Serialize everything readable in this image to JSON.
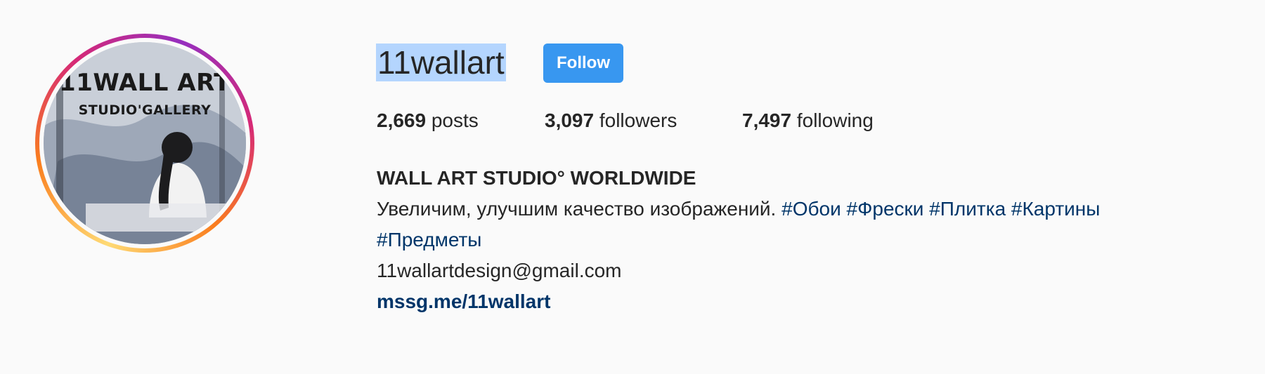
{
  "profile": {
    "username": "11wallart",
    "follow_label": "Follow",
    "avatar": {
      "line1": "11WALL ART",
      "line2": "STUDIO'GALLERY"
    },
    "stats": {
      "posts_count": "2,669",
      "posts_label": "posts",
      "followers_count": "3,097",
      "followers_label": "followers",
      "following_count": "7,497",
      "following_label": "following"
    },
    "bio": {
      "name": "WALL ART STUDIO° WORLDWIDE",
      "description": "Увеличим, улучшим качество изображений.",
      "hashtags": [
        "#Обои",
        "#Фрески",
        "#Плитка",
        "#Картины",
        "#Предметы"
      ],
      "email": "11wallartdesign@gmail.com",
      "link": "mssg.me/11wallart"
    }
  },
  "colors": {
    "background": "#fafafa",
    "follow_button": "#3897f0",
    "link": "#003569",
    "selection": "#b4d5fe",
    "text": "#262626"
  }
}
